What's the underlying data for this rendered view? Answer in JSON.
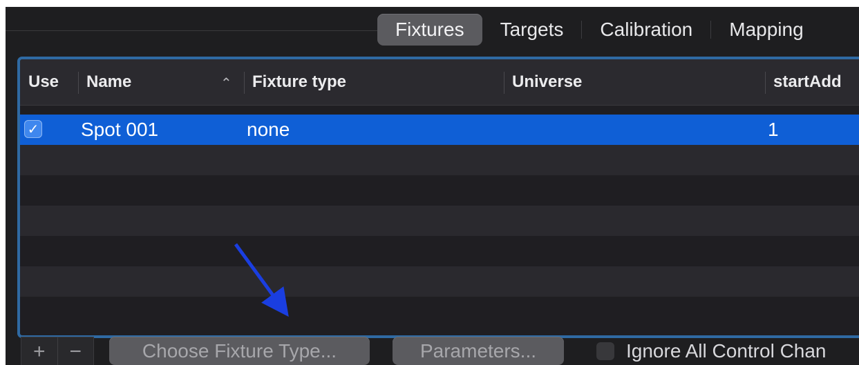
{
  "tabs": [
    {
      "label": "Fixtures",
      "selected": true
    },
    {
      "label": "Targets",
      "selected": false
    },
    {
      "label": "Calibration",
      "selected": false
    },
    {
      "label": "Mapping",
      "selected": false
    }
  ],
  "table": {
    "columns": {
      "use": "Use",
      "name": "Name",
      "fixture_type": "Fixture type",
      "universe": "Universe",
      "start_add": "startAdd"
    },
    "sort_indicator": "^",
    "rows": [
      {
        "use": true,
        "name": "Spot 001",
        "fixture_type": "none",
        "universe": "",
        "start_add": "1"
      }
    ]
  },
  "bottom": {
    "add_label": "+",
    "remove_label": "−",
    "choose_fixture_label": "Choose Fixture Type...",
    "parameters_label": "Parameters...",
    "ignore_label": "Ignore All Control Chan"
  },
  "icons": {
    "checkmark": "✓",
    "sort": "⌃"
  },
  "colors": {
    "selection": "#0f5fd6",
    "focus_ring": "#2f6aa3",
    "annotation_arrow": "#1a3ee0"
  }
}
